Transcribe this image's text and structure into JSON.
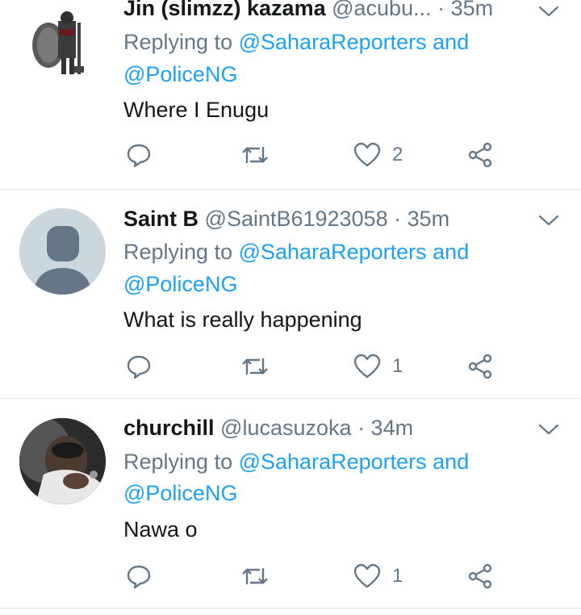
{
  "tweets": [
    {
      "name": "Jin (slimzz) kazama",
      "handle": "@acubu...",
      "time": "· 35m",
      "replying_prefix": "Replying to",
      "mention1": "@SaharaReporters",
      "and_word": "and",
      "mention2": "@PoliceNG",
      "text": "Where I Enugu",
      "like_count": "2",
      "avatar_icon": "armored-knight-avatar"
    },
    {
      "name": "Saint B",
      "handle": "@SaintB61923058",
      "time": "· 35m",
      "replying_prefix": "Replying to",
      "mention1": "@SaharaReporters",
      "and_word": "and",
      "mention2": "@PoliceNG",
      "text": "What is really happening",
      "like_count": "1",
      "avatar_icon": "default-person-avatar"
    },
    {
      "name": "churchill",
      "handle": "@lucasuzoka",
      "time": "· 34m",
      "replying_prefix": "Replying to",
      "mention1": "@SaharaReporters",
      "and_word": "and",
      "mention2": "@PoliceNG",
      "text": "Nawa o",
      "like_count": "1",
      "avatar_icon": "photo-avatar"
    }
  ],
  "colors": {
    "link": "#1da1f2",
    "secondary_text": "#657786",
    "icon": "#657786",
    "divider": "#e1e8ed",
    "default_avatar_bg": "#ccd6dd",
    "default_avatar_fg": "#657786"
  }
}
